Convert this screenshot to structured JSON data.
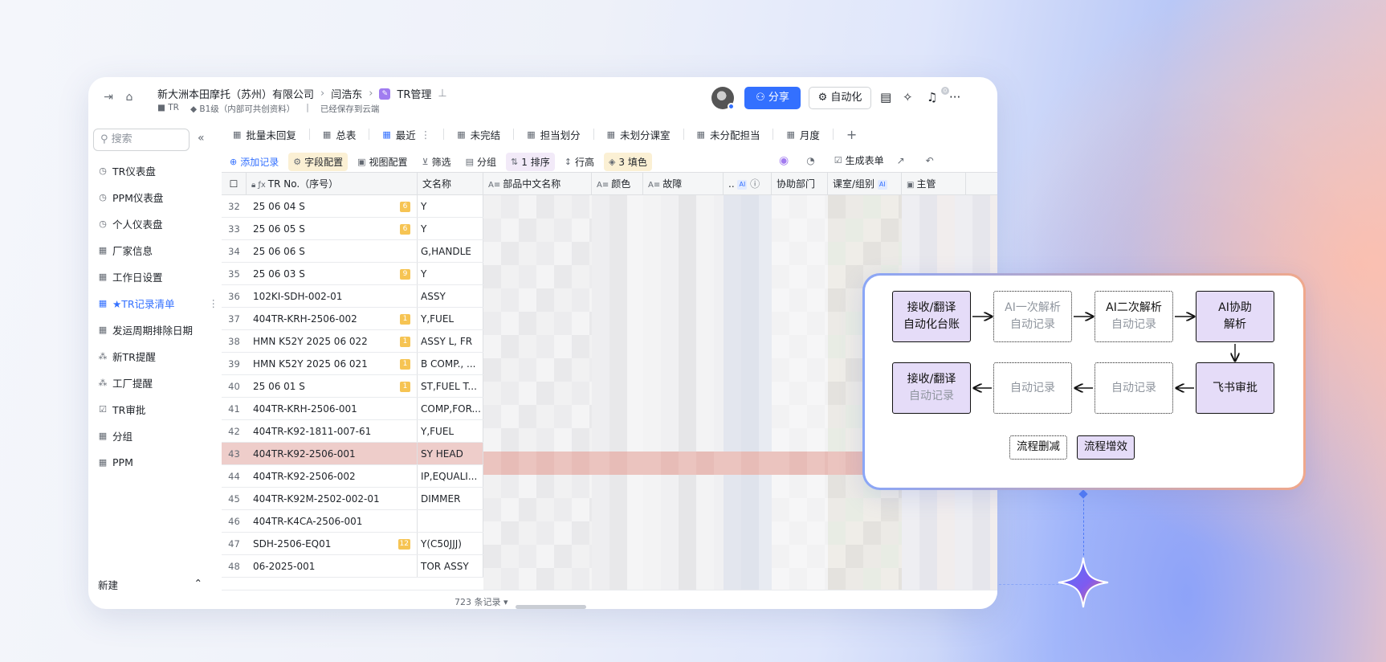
{
  "topbar": {
    "breadcrumb": [
      "新大洲本田摩托（苏州）有限公司",
      "闫浩东",
      "TR管理"
    ],
    "folder": "TR",
    "security": "B1级（内部可共创资料）",
    "save_status": "已经保存到云端",
    "share_label": "分享",
    "automation_label": "自动化",
    "bell_count": "0"
  },
  "sidebar": {
    "search_placeholder": "搜索",
    "items": [
      {
        "label": "TR仪表盘",
        "icon": "dashboard-icon"
      },
      {
        "label": "PPM仪表盘",
        "icon": "dashboard-icon"
      },
      {
        "label": "个人仪表盘",
        "icon": "dashboard-icon"
      },
      {
        "label": "厂家信息",
        "icon": "table-icon"
      },
      {
        "label": "工作日设置",
        "icon": "table-icon"
      },
      {
        "label": "★TR记录清单",
        "icon": "table-icon",
        "active": true
      },
      {
        "label": "发运周期排除日期",
        "icon": "table-icon"
      },
      {
        "label": "新TR提醒",
        "icon": "workflow-icon"
      },
      {
        "label": "工厂提醒",
        "icon": "workflow-icon"
      },
      {
        "label": "TR审批",
        "icon": "approval-icon"
      },
      {
        "label": "分组",
        "icon": "table-icon"
      },
      {
        "label": "PPM",
        "icon": "table-icon"
      }
    ],
    "new_label": "新建"
  },
  "tabs": [
    {
      "label": "批量未回复"
    },
    {
      "label": "总表"
    },
    {
      "label": "最近",
      "active": true
    },
    {
      "label": "未完结"
    },
    {
      "label": "担当划分"
    },
    {
      "label": "未划分课室"
    },
    {
      "label": "未分配担当"
    },
    {
      "label": "月度"
    }
  ],
  "toolbar": {
    "add": "添加记录",
    "fields": "字段配置",
    "view": "视图配置",
    "filter": "筛选",
    "group": "分组",
    "sort": "1 排序",
    "row_height": "行高",
    "fill": "3 填色",
    "generate_form": "生成表单"
  },
  "grid": {
    "headers": {
      "tr_no": "TR No.（序号）",
      "name_partial": "文名称",
      "part_cn": "部品中文名称",
      "color": "颜色",
      "fault": "故障",
      "dots": "..",
      "assist": "协助部门",
      "section": "课室/组别",
      "manager": "主管"
    },
    "rows": [
      {
        "idx": "32",
        "tr": "25 06 04 S",
        "lv": "6",
        "name": "Y"
      },
      {
        "idx": "33",
        "tr": "25 06 05 S",
        "lv": "6",
        "name": "Y"
      },
      {
        "idx": "34",
        "tr": "25 06 06 S",
        "lv": "",
        "name": "G,HANDLE"
      },
      {
        "idx": "35",
        "tr": "25 06 03 S",
        "lv": "9",
        "name": "Y"
      },
      {
        "idx": "36",
        "tr": "102KI-SDH-002-01",
        "lv": "",
        "name": "ASSY"
      },
      {
        "idx": "37",
        "tr": "404TR-KRH-2506-002",
        "lv": "1",
        "name": "Y,FUEL"
      },
      {
        "idx": "38",
        "tr": "HMN K52Y 2025 06 022",
        "lv": "1",
        "name": "ASSY L, FR"
      },
      {
        "idx": "39",
        "tr": "HMN K52Y 2025 06 021",
        "lv": "1",
        "name": "B COMP., ..."
      },
      {
        "idx": "40",
        "tr": "25 06 01 S",
        "lv": "1",
        "name": "ST,FUEL T..."
      },
      {
        "idx": "41",
        "tr": "404TR-KRH-2506-001",
        "lv": "",
        "name": "COMP,FOR..."
      },
      {
        "idx": "42",
        "tr": "404TR-K92-1811-007-61",
        "lv": "",
        "name": "Y,FUEL"
      },
      {
        "idx": "43",
        "tr": "404TR-K92-2506-001",
        "lv": "",
        "name": "SY HEAD",
        "selected": true
      },
      {
        "idx": "44",
        "tr": "404TR-K92-2506-002",
        "lv": "",
        "name": "IP,EQUALI..."
      },
      {
        "idx": "45",
        "tr": "404TR-K92M-2502-002-01",
        "lv": "",
        "name": "DIMMER"
      },
      {
        "idx": "46",
        "tr": "404TR-K4CA-2506-001",
        "lv": "",
        "name": ""
      },
      {
        "idx": "47",
        "tr": "SDH-2506-EQ01",
        "lv": "12",
        "name": "Y(C50JJJ)"
      },
      {
        "idx": "48",
        "tr": "06-2025-001",
        "lv": "",
        "name": "TOR ASSY"
      }
    ],
    "record_count": "723 条记录"
  },
  "flow": {
    "b1": [
      "接收/翻译",
      "自动化台账"
    ],
    "b2": [
      "AI一次解析",
      "自动记录"
    ],
    "b3": [
      "AI二次解析",
      "自动记录"
    ],
    "b4": [
      "AI协助",
      "解析"
    ],
    "b5": [
      "飞书审批"
    ],
    "b6": [
      "自动记录"
    ],
    "b7": [
      "自动记录"
    ],
    "b8": [
      "接收/翻译",
      "自动记录"
    ],
    "legend_reduce": "流程删减",
    "legend_improve": "流程增效"
  },
  "colors": {
    "accent": "#3370ff",
    "flow_fill": "#e5dcf8",
    "selected_row": "#eecdca",
    "level_badge": "#f6c453"
  }
}
